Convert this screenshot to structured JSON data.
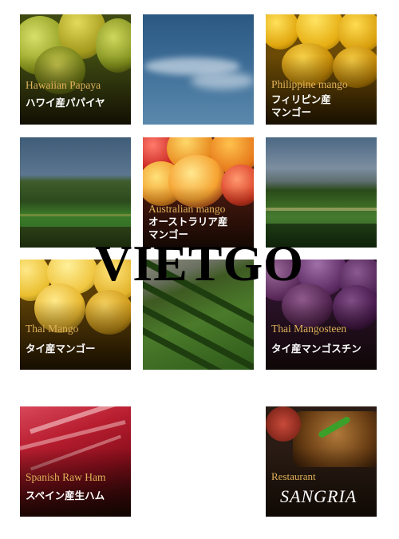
{
  "tiles": [
    {
      "id": "papaya",
      "en": "Hawaiian Papaya",
      "ja": "ハワイ産パパイヤ"
    },
    {
      "id": "sky",
      "en": "",
      "ja": ""
    },
    {
      "id": "ph-mango",
      "en": "Philippine mango",
      "ja": "フィリピン産\nマンゴー"
    },
    {
      "id": "field-1",
      "en": "",
      "ja": ""
    },
    {
      "id": "au-mango",
      "en": "Australian mango",
      "ja": "オーストラリア産\nマンゴー"
    },
    {
      "id": "field-2",
      "en": "",
      "ja": ""
    },
    {
      "id": "th-mango",
      "en": "Thai Mango",
      "ja": "タイ産マンゴー"
    },
    {
      "id": "orchard",
      "en": "",
      "ja": ""
    },
    {
      "id": "mangosteen",
      "en": "Thai Mangosteen",
      "ja": "タイ産マンゴスチン"
    },
    {
      "id": "ham",
      "en": "Spanish Raw Ham",
      "ja": "スペイン産生ハム"
    },
    {
      "id": "restaurant",
      "en": "Restaurant",
      "logo": "SANGRIA"
    }
  ],
  "watermark": "VIETGO"
}
